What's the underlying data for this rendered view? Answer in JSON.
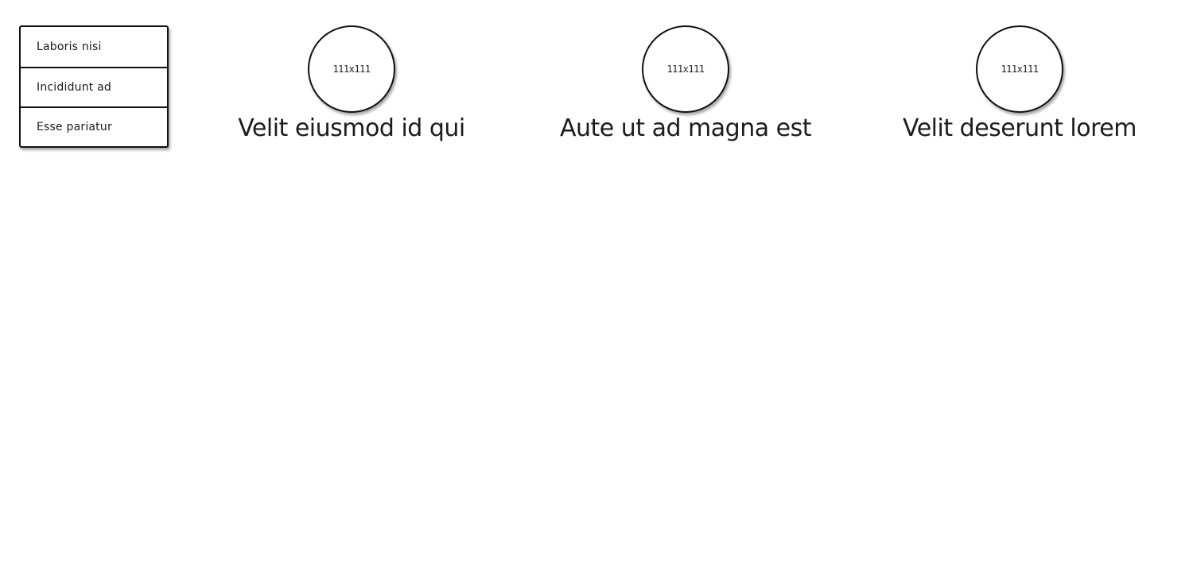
{
  "menu": {
    "items": [
      {
        "label": "Laboris nisi"
      },
      {
        "label": "Incididunt ad"
      },
      {
        "label": "Esse pariatur"
      }
    ]
  },
  "cards": [
    {
      "image_label": "111x111",
      "title": "Velit eiusmod id qui"
    },
    {
      "image_label": "111x111",
      "title": "Aute ut ad magna est"
    },
    {
      "image_label": "111x111",
      "title": "Velit deserunt lorem"
    }
  ]
}
